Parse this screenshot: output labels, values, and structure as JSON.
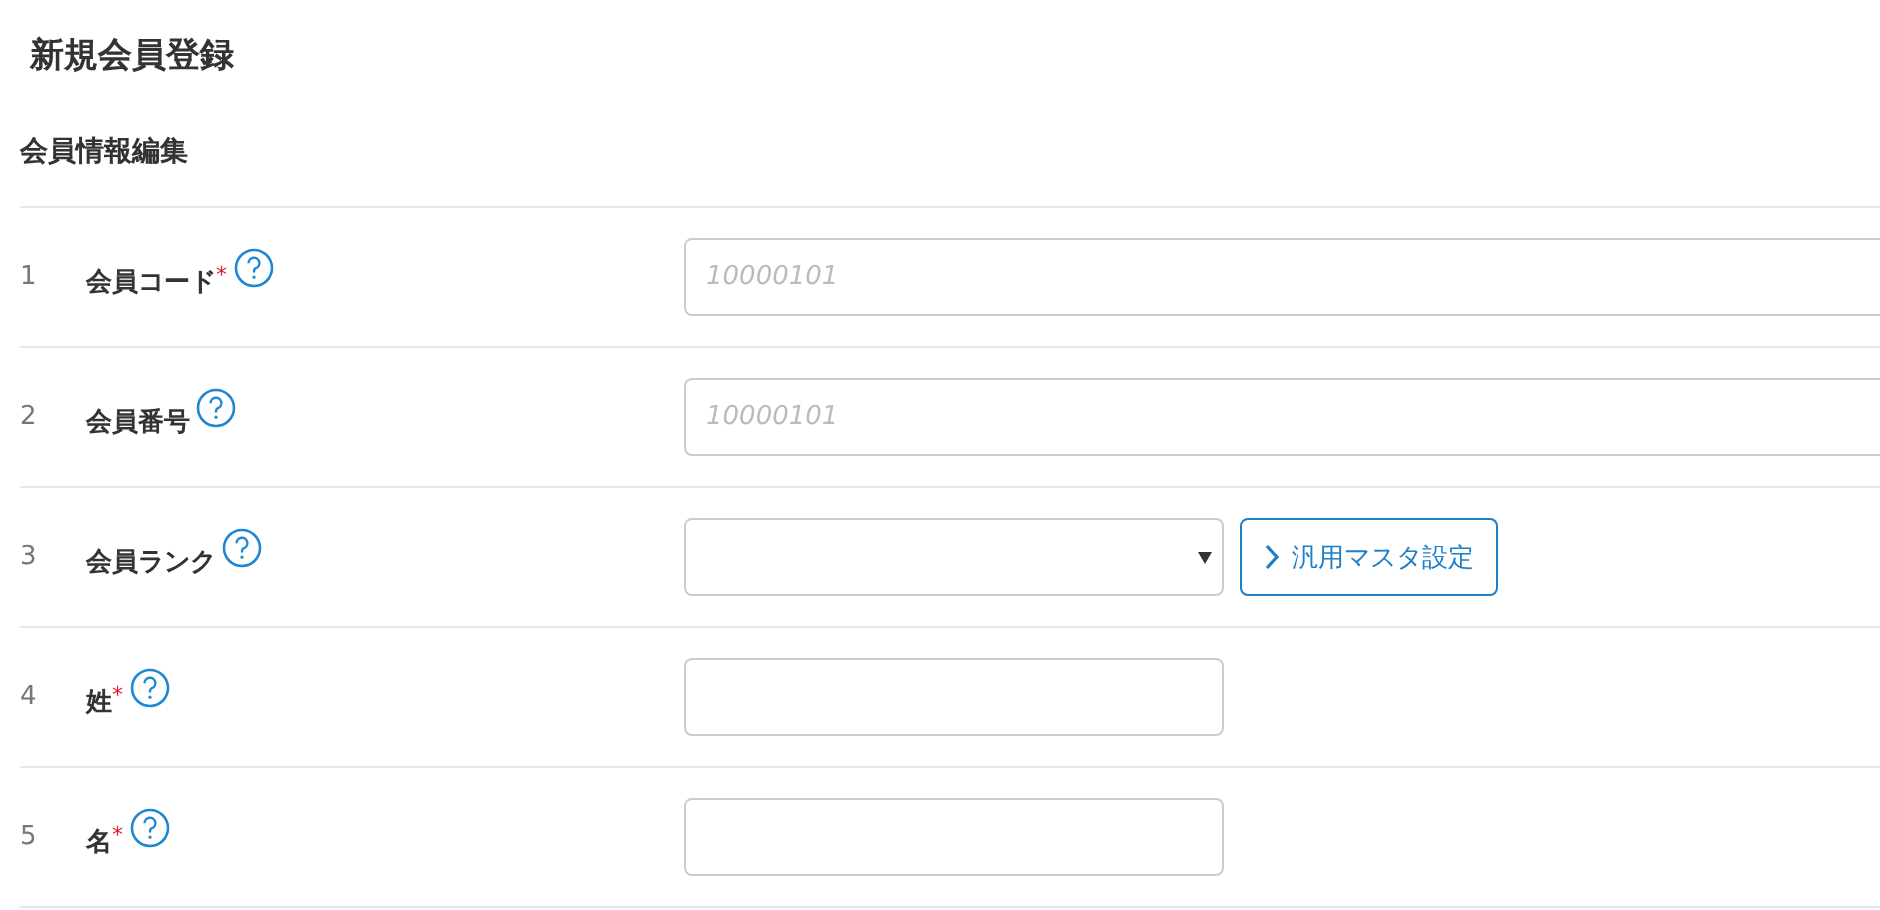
{
  "page_title": "新規会員登録",
  "section_title": "会員情報編集",
  "fields": [
    {
      "number": "1",
      "label": "会員コード",
      "required_mark": "*",
      "kind": "wide",
      "placeholder": "10000101"
    },
    {
      "number": "2",
      "label": "会員番号",
      "kind": "wide",
      "placeholder": "10000101"
    },
    {
      "number": "3",
      "label": "会員ランク",
      "kind": "select",
      "button": "汎用マスタ設定"
    },
    {
      "number": "4",
      "label": "姓",
      "required_mark": "*",
      "kind": "short"
    },
    {
      "number": "5",
      "label": "名",
      "required_mark": "*",
      "kind": "short"
    }
  ]
}
